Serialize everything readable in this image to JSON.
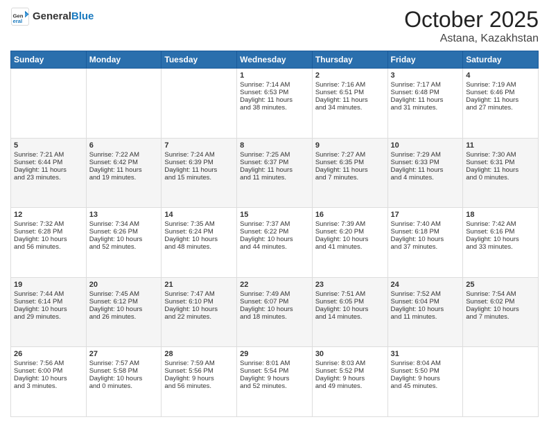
{
  "header": {
    "logo_general": "General",
    "logo_blue": "Blue",
    "month_title": "October 2025",
    "subtitle": "Astana, Kazakhstan"
  },
  "days_of_week": [
    "Sunday",
    "Monday",
    "Tuesday",
    "Wednesday",
    "Thursday",
    "Friday",
    "Saturday"
  ],
  "weeks": [
    [
      {
        "day": "",
        "text": ""
      },
      {
        "day": "",
        "text": ""
      },
      {
        "day": "",
        "text": ""
      },
      {
        "day": "1",
        "text": "Sunrise: 7:14 AM\nSunset: 6:53 PM\nDaylight: 11 hours\nand 38 minutes."
      },
      {
        "day": "2",
        "text": "Sunrise: 7:16 AM\nSunset: 6:51 PM\nDaylight: 11 hours\nand 34 minutes."
      },
      {
        "day": "3",
        "text": "Sunrise: 7:17 AM\nSunset: 6:48 PM\nDaylight: 11 hours\nand 31 minutes."
      },
      {
        "day": "4",
        "text": "Sunrise: 7:19 AM\nSunset: 6:46 PM\nDaylight: 11 hours\nand 27 minutes."
      }
    ],
    [
      {
        "day": "5",
        "text": "Sunrise: 7:21 AM\nSunset: 6:44 PM\nDaylight: 11 hours\nand 23 minutes."
      },
      {
        "day": "6",
        "text": "Sunrise: 7:22 AM\nSunset: 6:42 PM\nDaylight: 11 hours\nand 19 minutes."
      },
      {
        "day": "7",
        "text": "Sunrise: 7:24 AM\nSunset: 6:39 PM\nDaylight: 11 hours\nand 15 minutes."
      },
      {
        "day": "8",
        "text": "Sunrise: 7:25 AM\nSunset: 6:37 PM\nDaylight: 11 hours\nand 11 minutes."
      },
      {
        "day": "9",
        "text": "Sunrise: 7:27 AM\nSunset: 6:35 PM\nDaylight: 11 hours\nand 7 minutes."
      },
      {
        "day": "10",
        "text": "Sunrise: 7:29 AM\nSunset: 6:33 PM\nDaylight: 11 hours\nand 4 minutes."
      },
      {
        "day": "11",
        "text": "Sunrise: 7:30 AM\nSunset: 6:31 PM\nDaylight: 11 hours\nand 0 minutes."
      }
    ],
    [
      {
        "day": "12",
        "text": "Sunrise: 7:32 AM\nSunset: 6:28 PM\nDaylight: 10 hours\nand 56 minutes."
      },
      {
        "day": "13",
        "text": "Sunrise: 7:34 AM\nSunset: 6:26 PM\nDaylight: 10 hours\nand 52 minutes."
      },
      {
        "day": "14",
        "text": "Sunrise: 7:35 AM\nSunset: 6:24 PM\nDaylight: 10 hours\nand 48 minutes."
      },
      {
        "day": "15",
        "text": "Sunrise: 7:37 AM\nSunset: 6:22 PM\nDaylight: 10 hours\nand 44 minutes."
      },
      {
        "day": "16",
        "text": "Sunrise: 7:39 AM\nSunset: 6:20 PM\nDaylight: 10 hours\nand 41 minutes."
      },
      {
        "day": "17",
        "text": "Sunrise: 7:40 AM\nSunset: 6:18 PM\nDaylight: 10 hours\nand 37 minutes."
      },
      {
        "day": "18",
        "text": "Sunrise: 7:42 AM\nSunset: 6:16 PM\nDaylight: 10 hours\nand 33 minutes."
      }
    ],
    [
      {
        "day": "19",
        "text": "Sunrise: 7:44 AM\nSunset: 6:14 PM\nDaylight: 10 hours\nand 29 minutes."
      },
      {
        "day": "20",
        "text": "Sunrise: 7:45 AM\nSunset: 6:12 PM\nDaylight: 10 hours\nand 26 minutes."
      },
      {
        "day": "21",
        "text": "Sunrise: 7:47 AM\nSunset: 6:10 PM\nDaylight: 10 hours\nand 22 minutes."
      },
      {
        "day": "22",
        "text": "Sunrise: 7:49 AM\nSunset: 6:07 PM\nDaylight: 10 hours\nand 18 minutes."
      },
      {
        "day": "23",
        "text": "Sunrise: 7:51 AM\nSunset: 6:05 PM\nDaylight: 10 hours\nand 14 minutes."
      },
      {
        "day": "24",
        "text": "Sunrise: 7:52 AM\nSunset: 6:04 PM\nDaylight: 10 hours\nand 11 minutes."
      },
      {
        "day": "25",
        "text": "Sunrise: 7:54 AM\nSunset: 6:02 PM\nDaylight: 10 hours\nand 7 minutes."
      }
    ],
    [
      {
        "day": "26",
        "text": "Sunrise: 7:56 AM\nSunset: 6:00 PM\nDaylight: 10 hours\nand 3 minutes."
      },
      {
        "day": "27",
        "text": "Sunrise: 7:57 AM\nSunset: 5:58 PM\nDaylight: 10 hours\nand 0 minutes."
      },
      {
        "day": "28",
        "text": "Sunrise: 7:59 AM\nSunset: 5:56 PM\nDaylight: 9 hours\nand 56 minutes."
      },
      {
        "day": "29",
        "text": "Sunrise: 8:01 AM\nSunset: 5:54 PM\nDaylight: 9 hours\nand 52 minutes."
      },
      {
        "day": "30",
        "text": "Sunrise: 8:03 AM\nSunset: 5:52 PM\nDaylight: 9 hours\nand 49 minutes."
      },
      {
        "day": "31",
        "text": "Sunrise: 8:04 AM\nSunset: 5:50 PM\nDaylight: 9 hours\nand 45 minutes."
      },
      {
        "day": "",
        "text": ""
      }
    ]
  ]
}
